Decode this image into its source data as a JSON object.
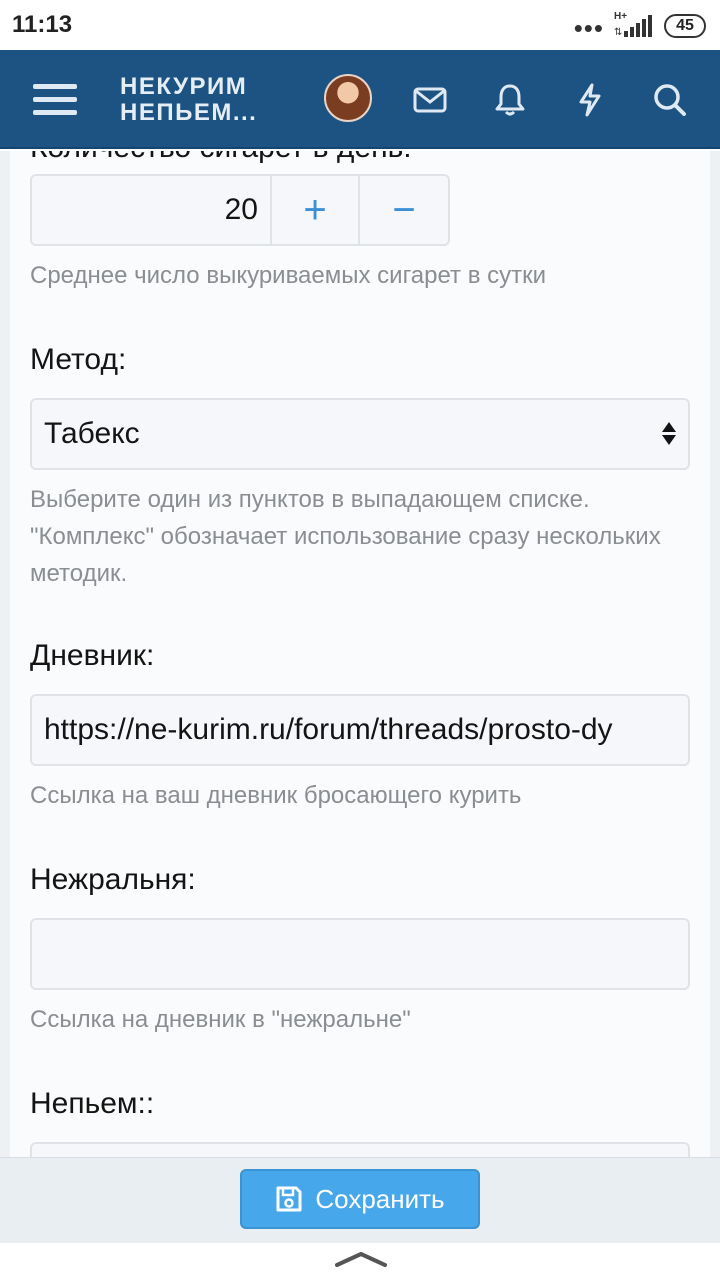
{
  "statusbar": {
    "time": "11:13",
    "network": "H+",
    "battery": "45"
  },
  "header": {
    "logo_line1": "НЕКУРИМ",
    "logo_line2": "НЕПЬЕМ..."
  },
  "form": {
    "cut_label": "Количество сигарет в день:",
    "cigarettes_value": "20",
    "plus_label": "+",
    "minus_label": "−",
    "cigarettes_hint": "Среднее число выкуриваемых сигарет в сутки",
    "method_label": "Метод:",
    "method_selected": "Табекс",
    "method_hint": "Выберите один из пунктов в выпадающем списке. \"Комплекс\" обозначает использование сразу нескольких методик.",
    "diary_label": "Дневник:",
    "diary_value": "https://ne-kurim.ru/forum/threads/prosto-dy",
    "diary_hint": "Ссылка на ваш дневник бросающего курить",
    "nezhralnya_label": "Нежральня:",
    "nezhralnya_value": "",
    "nezhralnya_hint": "Ссылка на дневник в \"нежральне\"",
    "nepyem_label": "Непьем::",
    "nepyem_value": ""
  },
  "actions": {
    "save_label": "Сохранить"
  },
  "colors": {
    "header_bg": "#1d5383",
    "accent": "#47a7eb",
    "hint_text": "#8a8d91"
  }
}
